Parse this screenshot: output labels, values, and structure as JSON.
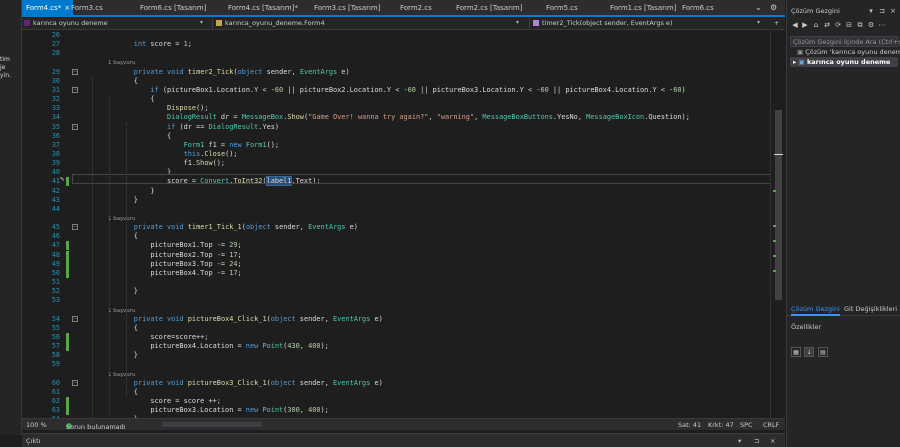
{
  "tabs": [
    {
      "label": "Form4.cs*",
      "active": true
    },
    {
      "label": "Form3.cs"
    },
    {
      "label": "Form6.cs [Tasarım]"
    },
    {
      "label": "Form4.cs [Tasarım]*"
    },
    {
      "label": "Form3.cs [Tasarım]"
    },
    {
      "label": "Form2.cs"
    },
    {
      "label": "Form2.cs [Tasarım]"
    },
    {
      "label": "Form5.cs"
    },
    {
      "label": "Form1.cs [Tasarım]"
    },
    {
      "label": "Form6.cs"
    }
  ],
  "tab_close": "×",
  "tab_controls": [
    "⌄",
    "⚙"
  ],
  "left_strip": [
    "tim",
    "je",
    "yin."
  ],
  "nav": {
    "project": "karınca oyunu deneme",
    "class": "karınca_oyunu_deneme.Form4",
    "member": "timer2_Tick(object sender, EventArgs e)",
    "dropdown": "▾",
    "split": "+"
  },
  "code": {
    "lines": [
      {
        "n": "26"
      },
      {
        "n": "27",
        "t": "            int score = 1;"
      },
      {
        "n": "28"
      },
      {
        "ref": "1 başvuru"
      },
      {
        "n": "29",
        "t": "            private void timer2_Tick(object sender, EventArgs e)"
      },
      {
        "n": "30",
        "t": "            {"
      },
      {
        "n": "31",
        "t": "                if (pictureBox1.Location.Y < -60 || pictureBox2.Location.Y < -60 || pictureBox3.Location.Y < -60 || pictureBox4.Location.Y < -60)"
      },
      {
        "n": "32",
        "t": "                {"
      },
      {
        "n": "33",
        "t": "                    Dispose();"
      },
      {
        "n": "34",
        "t": "                    DialogResult dr = MessageBox.Show(\"Game Over! wanna try again?\", \"warning\", MessageBoxButtons.YesNo, MessageBoxIcon.Question);"
      },
      {
        "n": "35",
        "t": "                    if (dr == DialogResult.Yes)"
      },
      {
        "n": "36",
        "t": "                    {"
      },
      {
        "n": "37",
        "t": "                        Form1 f1 = new Form1();"
      },
      {
        "n": "38",
        "t": "                        this.Close();"
      },
      {
        "n": "39",
        "t": "                        f1.Show();"
      },
      {
        "n": "40",
        "t": "                    }"
      },
      {
        "n": "41",
        "t": "                    score = Convert.ToInt32(label1.Text);"
      },
      {
        "n": "42",
        "t": "                }"
      },
      {
        "n": "43",
        "t": "            }"
      },
      {
        "n": "44"
      },
      {
        "ref": "1 başvuru"
      },
      {
        "n": "45",
        "t": "            private void timer1_Tick_1(object sender, EventArgs e)"
      },
      {
        "n": "46",
        "t": "            {"
      },
      {
        "n": "47",
        "t": "                pictureBox1.Top -= 29;"
      },
      {
        "n": "48",
        "t": "                pictureBox2.Top -= 17;"
      },
      {
        "n": "49",
        "t": "                pictureBox3.Top -= 24;"
      },
      {
        "n": "50",
        "t": "                pictureBox4.Top -= 17;"
      },
      {
        "n": "51"
      },
      {
        "n": "52",
        "t": "            }"
      },
      {
        "n": "53"
      },
      {
        "ref": "1 başvuru"
      },
      {
        "n": "54",
        "t": "            private void pictureBox4_Click_1(object sender, EventArgs e)"
      },
      {
        "n": "55",
        "t": "            {"
      },
      {
        "n": "56",
        "t": "                score=score++;"
      },
      {
        "n": "57",
        "t": "                pictureBox4.Location = new Point(430, 400);"
      },
      {
        "n": "58",
        "t": "            }"
      },
      {
        "n": "59"
      },
      {
        "ref": "1 başvuru"
      },
      {
        "n": "60",
        "t": "            private void pictureBox3_Click_1(object sender, EventArgs e)"
      },
      {
        "n": "61",
        "t": "            {"
      },
      {
        "n": "62",
        "t": "                score = score ++;"
      },
      {
        "n": "63",
        "t": "                pictureBox3.Location = new Point(300, 400);"
      },
      {
        "n": "64",
        "t": "            }"
      }
    ]
  },
  "status": {
    "zoom": "100 %",
    "issues": "Sorun bulunamadı",
    "line": "Sat: 41",
    "col": "Krkt: 47",
    "space": "SPC",
    "eol": "CRLF"
  },
  "output": {
    "title": "Çıktı"
  },
  "solution": {
    "title": "Çözüm Gezgini",
    "search_placeholder": "Çözüm Gezgini İçinde Ara (Ctrl+ş)",
    "search_value": "",
    "root": "Çözüm 'karınca oyunu deneme'",
    "project": "karınca oyunu deneme",
    "window_controls": [
      "▾",
      "⊐",
      "×"
    ]
  },
  "bottom_tabs": [
    "Çözüm Gezgini",
    "Git Değişiklikleri"
  ],
  "properties": {
    "title": "Özellikler"
  },
  "colors": {
    "accent": "#007acc",
    "ok": "#3a9b4c",
    "change": "#57a64a"
  }
}
